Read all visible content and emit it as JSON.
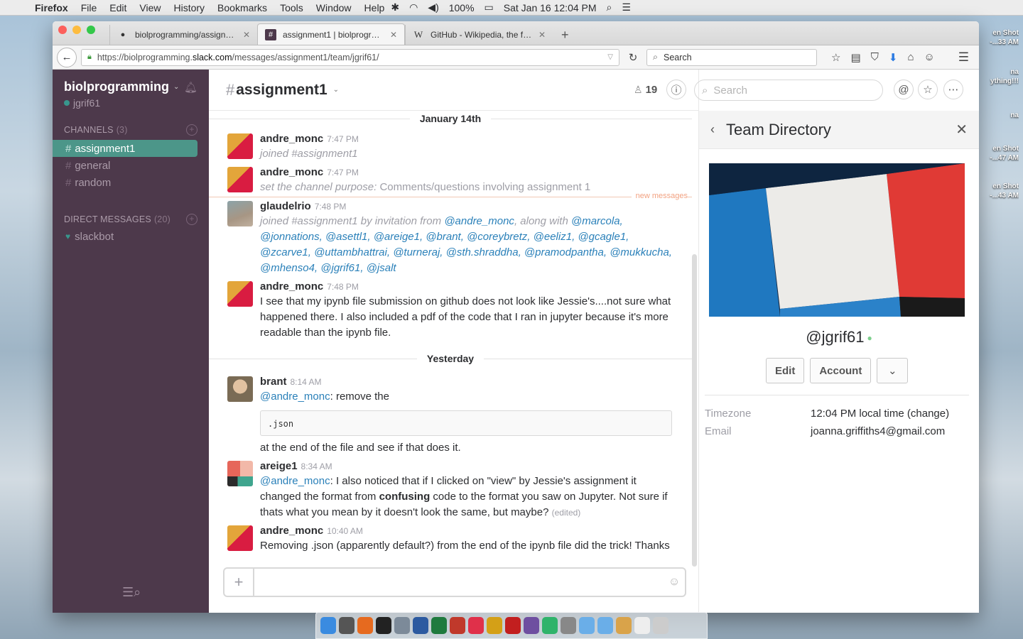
{
  "menubar": {
    "app": "Firefox",
    "items": [
      "File",
      "Edit",
      "View",
      "History",
      "Bookmarks",
      "Tools",
      "Window",
      "Help"
    ],
    "battery": "100%",
    "datetime": "Sat Jan 16  12:04 PM"
  },
  "desktop_labels": [
    "en Shot\n-...33 AM",
    "na\nything!!!",
    "na",
    "en Shot\n-...47 AM",
    "en Shot\n-...43 AM"
  ],
  "browser": {
    "tabs": [
      {
        "title": "biolprogramming/assignme...",
        "icon": "github-icon"
      },
      {
        "title": "assignment1 | biolprogram...",
        "icon": "slack-hash-icon"
      },
      {
        "title": "GitHub - Wikipedia, the free...",
        "icon": "wikipedia-icon"
      }
    ],
    "url_prefix": "https://biolprogramming.",
    "url_domain": "slack.com",
    "url_path": "/messages/assignment1/team/jgrif61/",
    "search_placeholder": "Search"
  },
  "sidebar": {
    "team_name": "biolprogramming",
    "username": "jgrif61",
    "channels_label": "CHANNELS",
    "channels_count": "(3)",
    "channels": [
      "assignment1",
      "general",
      "random"
    ],
    "dm_label": "DIRECT MESSAGES",
    "dm_count": "(20)",
    "dms": [
      "slackbot"
    ]
  },
  "channel": {
    "name": "assignment1",
    "member_count": "19",
    "search_placeholder": "Search"
  },
  "messages": {
    "day1": "January 14th",
    "m1_user": "andre_monc",
    "m1_time": "7:47 PM",
    "m1_text": "joined #assignment1",
    "m2_user": "andre_monc",
    "m2_time": "7:47 PM",
    "m2_pre": "set the channel purpose:",
    "m2_text": " Comments/questions involving assignment 1",
    "new_messages": "new messages",
    "m3_user": "glaudelrio",
    "m3_time": "7:48 PM",
    "m3_pre": "joined #assignment1 by invitation from ",
    "m3_inviter": "@andre_monc",
    "m3_mid": ", along with ",
    "m3_mentions": "@marcola, @jonnations, @asettl1, @areige1, @brant, @coreybretz, @eeliz1, @gcagle1, @zcarve1, @uttambhattrai, @turneraj, @sth.shraddha, @pramodpantha, @mukkucha, @mhenso4, @jgrif61, @jsalt",
    "m4_user": "andre_monc",
    "m4_time": "7:48 PM",
    "m4_text": "I see that my ipynb file submission on github does not look like Jessie's....not sure what happened there. I also included a pdf of the code that I ran in jupyter because it's more readable than the ipynb file.",
    "day2": "Yesterday",
    "m5_user": "brant",
    "m5_time": "8:14 AM",
    "m5_mention": "@andre_monc",
    "m5_text": ": remove the",
    "m5_code": ".json",
    "m5_after": "at the end of the file and see if that does it.",
    "m6_user": "areige1",
    "m6_time": "8:34 AM",
    "m6_mention": "@andre_monc",
    "m6_text1": ": I also noticed that if I clicked on \"view\" by Jessie's assignment it changed the format from ",
    "m6_bold": "confusing",
    "m6_text2": " code to the format you saw on Jupyter. Not sure if thats what you mean by it doesn't look the same, but maybe?",
    "m6_edited": "(edited)",
    "m7_user": "andre_monc",
    "m7_time": "10:40 AM",
    "m7_text": "Removing .json (apparently default?) from the end of the ipynb file did the trick! Thanks"
  },
  "panel": {
    "title": "Team Directory",
    "handle": "@jgrif61",
    "edit_label": "Edit",
    "account_label": "Account",
    "timezone_label": "Timezone",
    "timezone_value": "12:04 PM local time (change)",
    "email_label": "Email",
    "email_value": "joanna.griffiths4@gmail.com"
  },
  "colors": {
    "sidebar_bg": "#4d394b",
    "active_channel": "#4c9689",
    "mention": "#2a80b9",
    "presence_green": "#38978d"
  }
}
